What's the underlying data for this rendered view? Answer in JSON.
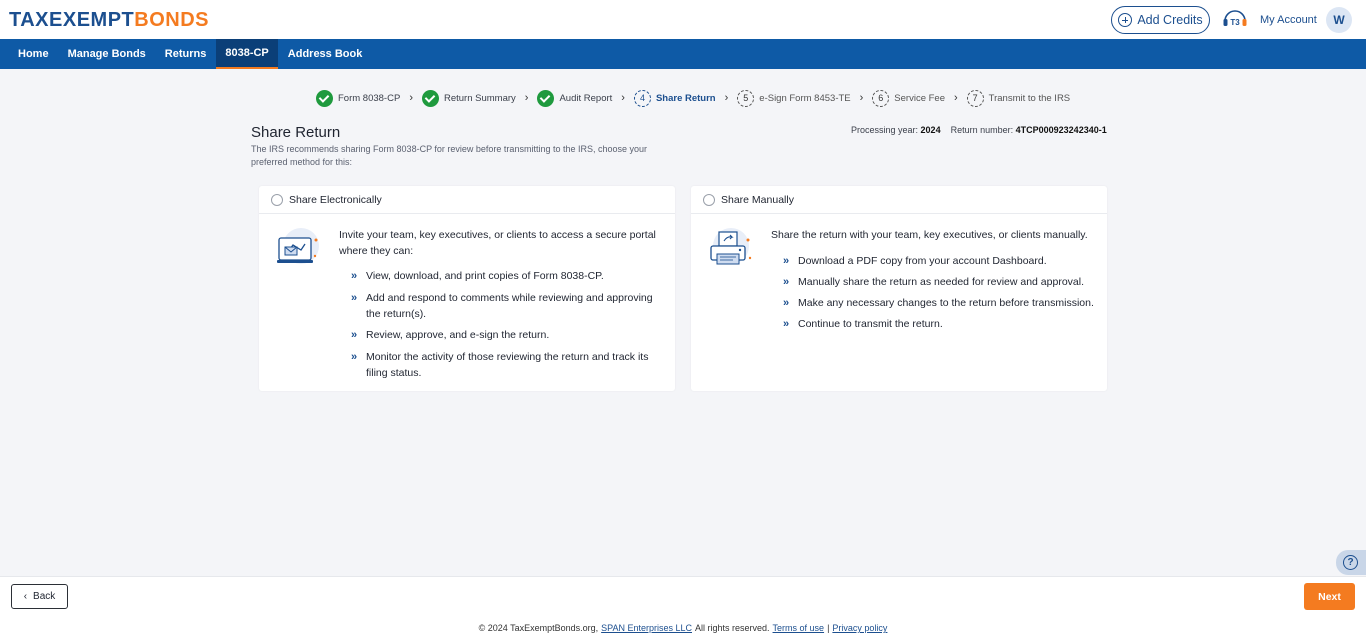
{
  "header": {
    "logo_prefix": "TAXEXEMPT",
    "logo_suffix": "BONDS",
    "add_credits": "Add Credits",
    "my_account": "My Account",
    "avatar_initial": "W"
  },
  "nav": {
    "items": [
      "Home",
      "Manage Bonds",
      "Returns",
      "8038-CP",
      "Address Book"
    ],
    "active": "8038-CP"
  },
  "stepper": {
    "steps": [
      {
        "num": "1",
        "label": "Form 8038-CP",
        "status": "done"
      },
      {
        "num": "2",
        "label": "Return Summary",
        "status": "done"
      },
      {
        "num": "3",
        "label": "Audit Report",
        "status": "done"
      },
      {
        "num": "4",
        "label": "Share Return",
        "status": "current"
      },
      {
        "num": "5",
        "label": "e-Sign Form 8453-TE",
        "status": "future"
      },
      {
        "num": "6",
        "label": "Service Fee",
        "status": "future"
      },
      {
        "num": "7",
        "label": "Transmit to the IRS",
        "status": "future"
      }
    ]
  },
  "page": {
    "title": "Share Return",
    "description": "The IRS recommends sharing Form 8038-CP for review before transmitting to the IRS, choose your preferred method for this:",
    "processing_year_label": "Processing year:",
    "processing_year": "2024",
    "return_number_label": "Return number:",
    "return_number": "4TCP000923242340-1"
  },
  "share_electronically": {
    "label": "Share Electronically",
    "intro": "Invite your team, key executives, or clients to access a secure portal where they can:",
    "bullets": [
      "View, download, and print copies of Form 8038-CP.",
      "Add and respond to comments while reviewing and approving the return(s).",
      "Review, approve, and e-sign the return.",
      "Monitor the activity of those reviewing the return and track its filing status."
    ]
  },
  "share_manually": {
    "label": "Share Manually",
    "intro": "Share the return with your team, key executives, or clients manually.",
    "bullets": [
      "Download a PDF copy from your account Dashboard.",
      "Manually share the return as needed for review and approval.",
      "Make any necessary changes to the return before transmission.",
      "Continue to transmit the return."
    ]
  },
  "actions": {
    "back": "Back",
    "next": "Next",
    "help": "?"
  },
  "footer": {
    "copyright": "© 2024 TaxExemptBonds.org,",
    "company": "SPAN Enterprises LLC",
    "rights": "All rights reserved.",
    "terms": "Terms of use",
    "separator": "|",
    "privacy": "Privacy policy"
  },
  "colors": {
    "brand_blue": "#0e5aa6",
    "brand_orange": "#f47b20",
    "success_green": "#1f9a3e"
  }
}
